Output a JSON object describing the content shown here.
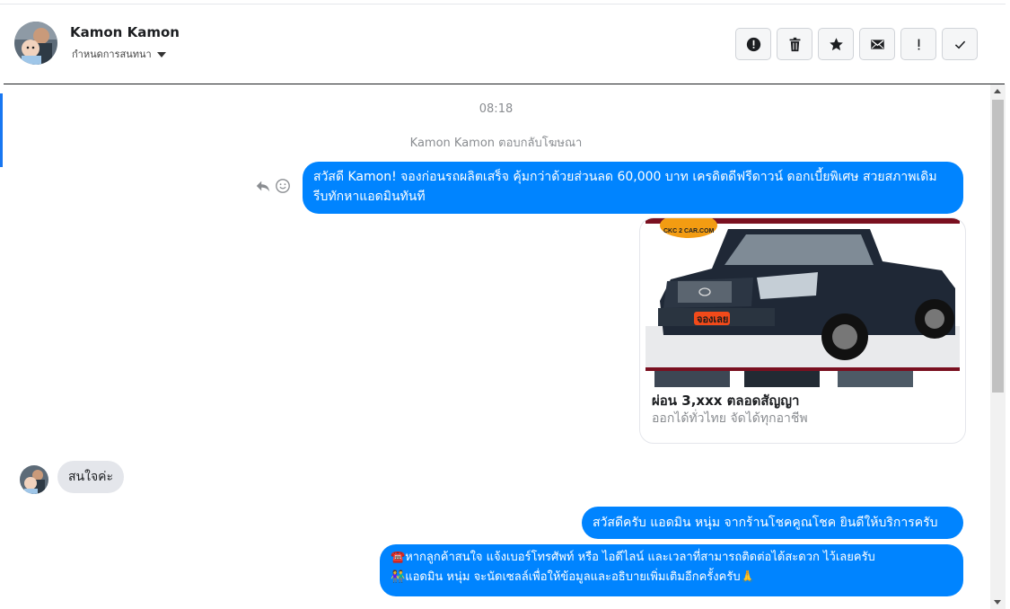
{
  "contact": {
    "name": "Kamon Kamon",
    "subtitle": "กำหนดการสนทนา"
  },
  "toolbar": {
    "buttons": [
      {
        "icon": "alert-circle-icon",
        "name": "mark-spam-button"
      },
      {
        "icon": "trash-icon",
        "name": "delete-button"
      },
      {
        "icon": "star-icon",
        "name": "star-button"
      },
      {
        "icon": "envelope-icon",
        "name": "mark-unread-button"
      },
      {
        "icon": "exclamation-icon",
        "name": "follow-up-button"
      },
      {
        "icon": "check-icon",
        "name": "mark-done-button"
      }
    ]
  },
  "conversation": {
    "timestamp": "08:18",
    "reply_note": "Kamon Kamon ตอบกลับโฆษณา",
    "messages": {
      "ad_message": "สวัสดี Kamon! จองก่อนรถผลิตเสร็จ คุ้มกว่าด้วยส่วนลด 60,000 บาท เครดิตดีฟรีดาวน์ ดอกเบี้ยพิเศษ สวยสภาพเดิม รีบทักหาแอดมินทันที",
      "ad_card": {
        "title": "ผ่อน 3,xxx ตลอดสัญญา",
        "subtitle": "ออกได้ทั่วไทย จัดได้ทุกอาชีพ",
        "logo_text": "CKC 2 CAR.COM",
        "badge_text": "จองเลย"
      },
      "customer_reply": "สนใจค่ะ",
      "admin_greeting": "สวัสดีครับ แอดมิน หนุ่ม จากร้านโชคคูณโชค ยินดีให้บริการครับ",
      "admin_info_line1": "หากลูกค้าสนใจ แจ้งเบอร์โทรศัพท์ หรือ ไอดีไลน์ และเวลาที่สามารถติดต่อได้สะดวก ไว้เลยครับ",
      "admin_info_line2": "แอดมิน หนุ่ม จะนัดเซลล์เพื่อให้ข้อมูลและอธิบายเพิ่มเติมอีกครั้งครับ",
      "emoji_phone": "☎️",
      "emoji_people": "👫",
      "emoji_pray": "🙏"
    }
  },
  "colors": {
    "outgoing_bubble": "#0084ff",
    "incoming_bubble": "#e4e6eb",
    "accent": "#1877f2"
  }
}
